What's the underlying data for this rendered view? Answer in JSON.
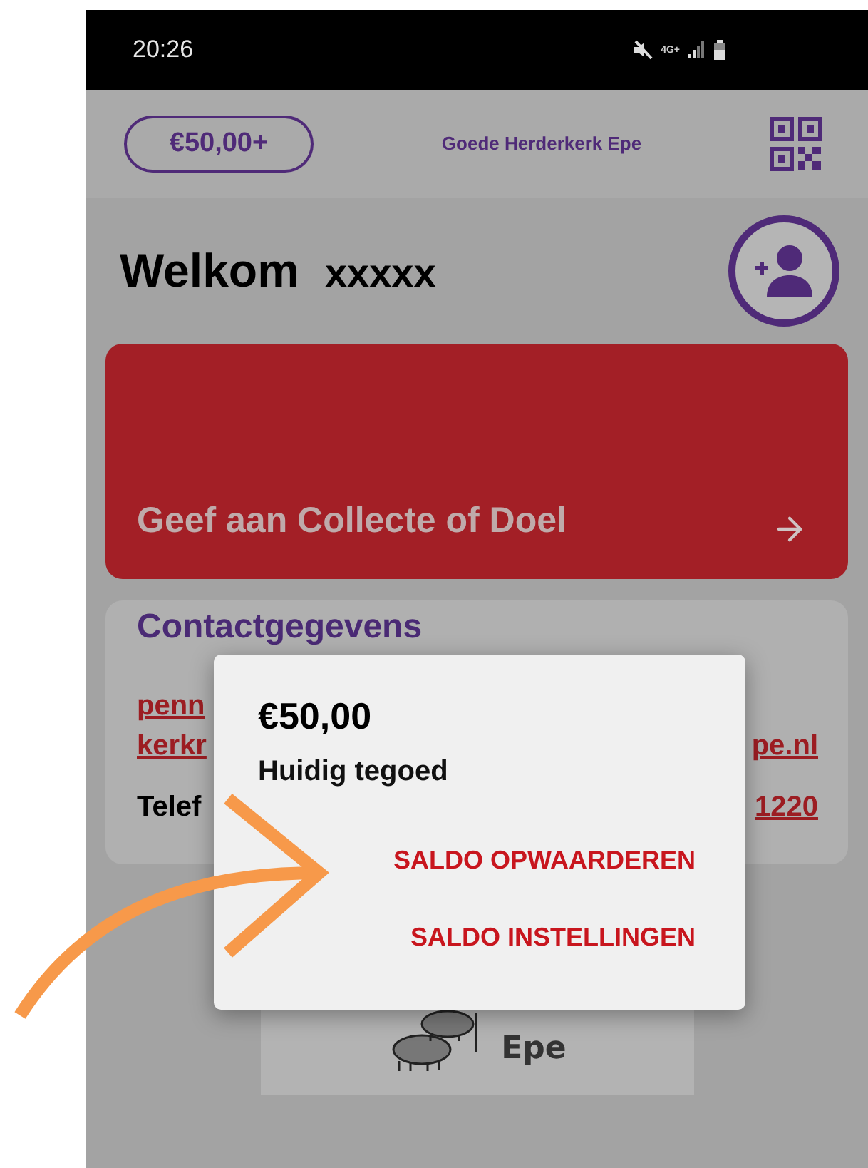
{
  "status_bar": {
    "time": "20:26",
    "network": "4G+"
  },
  "header": {
    "balance_badge": "€50,00+",
    "church_name": "Goede Herderkerk Epe"
  },
  "welcome": {
    "greeting": "Welkom",
    "name": "xxxxx"
  },
  "give_card": {
    "label": "Geef aan Collecte of Doel"
  },
  "contact_card": {
    "title": "Contactgegevens",
    "email_line_1": "penn",
    "email_line_2": "kerkr",
    "email_end": "pe.nl",
    "phone_label": "Telef",
    "phone_end": "1220"
  },
  "logo": {
    "text": "Epe"
  },
  "balance_dialog": {
    "amount": "€50,00",
    "caption": "Huidig tegoed",
    "actions": [
      "SALDO OPWAARDEREN",
      "SALDO INSTELLINGEN"
    ]
  }
}
